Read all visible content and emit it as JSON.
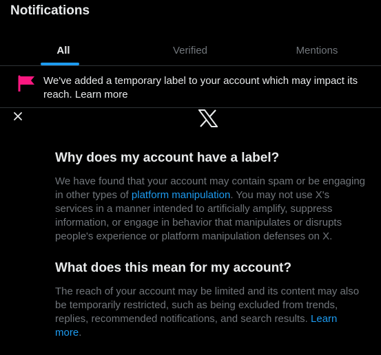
{
  "header": {
    "title": "Notifications",
    "tabs": [
      {
        "label": "All",
        "active": true
      },
      {
        "label": "Verified",
        "active": false
      },
      {
        "label": "Mentions",
        "active": false
      }
    ]
  },
  "banner": {
    "text": "We've added a temporary label to your account which may impact its reach.",
    "link": "Learn more",
    "flag_color": "#f91880"
  },
  "modal": {
    "close_icon": "close-icon",
    "logo": "x-logo",
    "section1": {
      "heading": "Why does my account have a label?",
      "text_before": "We have found that your account may contain spam or be engaging in other types of ",
      "link": "platform manipulation",
      "text_after": ". You may not use X's services in a manner intended to artificially amplify, suppress information, or engage in behavior that manipulates or disrupts people's experience or platform manipulation defenses on X."
    },
    "section2": {
      "heading": "What does this mean for my account?",
      "text": "The reach of your account may be limited and its content may also be temporarily restricted, such as being excluded from trends, replies, recommended notifications, and search results. ",
      "link": "Learn more",
      "text_after": "."
    }
  },
  "colors": {
    "accent": "#1d9bf0",
    "background": "#000000",
    "text_primary": "#e7e9ea",
    "text_secondary": "#71767b"
  }
}
